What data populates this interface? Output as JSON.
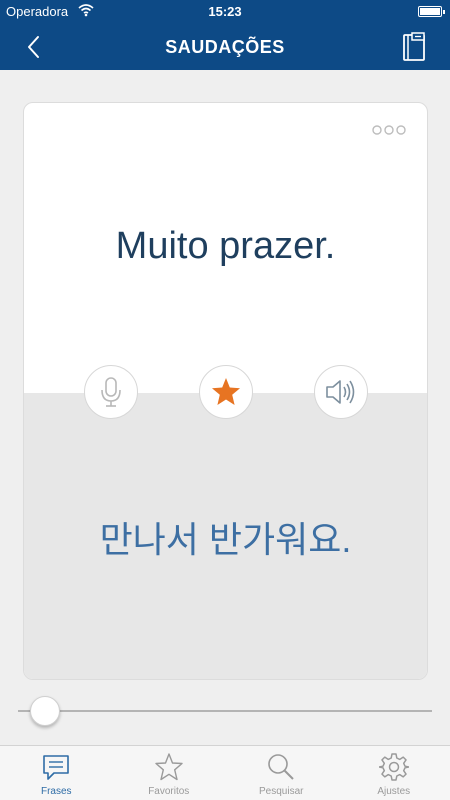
{
  "status_bar": {
    "carrier": "Operadora",
    "time": "15:23"
  },
  "nav": {
    "title": "SAUDAÇÕES",
    "back_icon": "chevron-left-icon",
    "right_icon": "notebook-icon"
  },
  "card": {
    "phrase": "Muito prazer.",
    "translation": "만나서 반가워요.",
    "buttons": {
      "mic": "microphone-icon",
      "star": "star-icon",
      "speaker": "speaker-icon"
    },
    "star_color": "#e77422"
  },
  "slider": {
    "position_fraction": 0.03
  },
  "tabs": [
    {
      "label": "Frases",
      "icon": "chat-bubble-icon",
      "active": true
    },
    {
      "label": "Favoritos",
      "icon": "star-outline-icon",
      "active": false
    },
    {
      "label": "Pesquisar",
      "icon": "search-icon",
      "active": false
    },
    {
      "label": "Ajustes",
      "icon": "gear-icon",
      "active": false
    }
  ],
  "colors": {
    "nav_bar": "#0d4a86",
    "accent": "#2e6ca6",
    "phrase_text": "#1f3f5e",
    "translation_text": "#3d6fa3"
  }
}
